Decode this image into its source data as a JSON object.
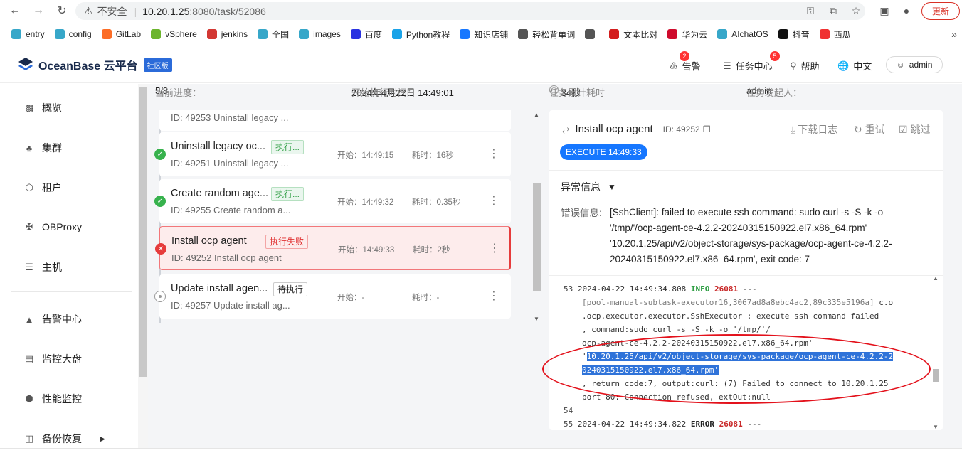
{
  "browser": {
    "not_secure": "不安全",
    "url_host": "10.20.1.25",
    "url_path": ":8080/task/52086",
    "update_label": "更新"
  },
  "bookmarks": [
    {
      "label": "entry",
      "color": "#37a7c9"
    },
    {
      "label": "config",
      "color": "#37a7c9"
    },
    {
      "label": "GitLab",
      "color": "#fc6d26"
    },
    {
      "label": "vSphere",
      "color": "#6cb52d"
    },
    {
      "label": "jenkins",
      "color": "#d33833"
    },
    {
      "label": "全国",
      "color": "#37a7c9"
    },
    {
      "label": "images",
      "color": "#37a7c9"
    },
    {
      "label": "百度",
      "color": "#2932e1"
    },
    {
      "label": "Python教程",
      "color": "#1aa3e8"
    },
    {
      "label": "知识店铺",
      "color": "#1677ff"
    },
    {
      "label": "轻松背单词",
      "color": "#555555"
    },
    {
      "label": "",
      "color": "#555555"
    },
    {
      "label": "文本比对",
      "color": "#d31d1d"
    },
    {
      "label": "华为云",
      "color": "#cf0a2c"
    },
    {
      "label": "AIchatOS",
      "color": "#37a7c9"
    },
    {
      "label": "抖音",
      "color": "#111111"
    },
    {
      "label": "西瓜",
      "color": "#f03131"
    }
  ],
  "header": {
    "brand": "OceanBase 云平台",
    "edition": "社区版",
    "alerts": "告警",
    "alerts_count": "2",
    "tasks": "任务中心",
    "tasks_count": "5",
    "help": "帮助",
    "language": "中文",
    "user": "admin"
  },
  "sidebar": {
    "items": [
      {
        "label": "概览"
      },
      {
        "label": "集群"
      },
      {
        "label": "租户"
      },
      {
        "label": "OBProxy"
      },
      {
        "label": "主机"
      },
      {
        "label": "告警中心"
      },
      {
        "label": "监控大盘"
      },
      {
        "label": "性能监控"
      },
      {
        "label": "备份恢复"
      }
    ]
  },
  "progress": {
    "label": "当前进度：",
    "value": "5/8",
    "start_label": "开始执行时间：",
    "start_value": "2024年4月22日 14:49:01",
    "cost_label": "任务累计耗时",
    "cost_value": "34秒",
    "initiator_label": "任务发起人：",
    "initiator_value": "admin"
  },
  "tasks": [
    {
      "name": "",
      "tag": "",
      "id": "ID: 49253  Uninstall legacy ...",
      "start": "",
      "cost": "",
      "status": "ok"
    },
    {
      "name": "Uninstall legacy oc...",
      "tag": "执行...",
      "id": "ID: 49251  Uninstall legacy ...",
      "start": "开始：14:49:15",
      "cost": "耗时：16秒",
      "status": "ok"
    },
    {
      "name": "Create random age...",
      "tag": "执行...",
      "id": "ID: 49255  Create random  a...",
      "start": "开始：14:49:32",
      "cost": "耗时：0.35秒",
      "status": "ok"
    },
    {
      "name": "Install ocp agent",
      "tag": "执行失败",
      "id": "ID: 49252  Install ocp agent",
      "start": "开始：14:49:33",
      "cost": "耗时：2秒",
      "status": "fail"
    },
    {
      "name": "Update install agen...",
      "tag": "待执行",
      "id": "ID: 49257  Update install ag...",
      "start": "开始：-",
      "cost": "耗时：-",
      "status": "pending"
    }
  ],
  "detail": {
    "title": "Install ocp agent",
    "id": "ID: 49252",
    "download_log": "下载日志",
    "retry": "重试",
    "skip": "跳过",
    "exec_pill": "EXECUTE 14:49:33",
    "error_section": "异常信息",
    "error_label": "错误信息:",
    "error_message": "[SshClient]: failed to execute ssh command: sudo curl -s -S -k -o '/tmp/'/ocp-agent-ce-4.2.2-20240315150922.el7.x86_64.rpm' '10.20.1.25/api/v2/object-storage/sys-package/ocp-agent-ce-4.2.2-20240315150922.el7.x86_64.rpm', exit code: 7"
  },
  "log": {
    "l53_num": "53",
    "l53_time": "2024-04-22 14:49:34.808",
    "l53_level": "INFO",
    "l53_pid": "26081",
    "l53_dash": "---",
    "l53_thread": "[pool-manual-subtask-executor16,3067ad8a8ebc4ac2,89c335e5196a]",
    "l53_cls1": "c.o",
    "l53_cls2": ".ocp.executor.executor.SshExecutor",
    "l53_msg1": ": execute ssh command failed",
    "l53_msg2": ", command:sudo curl -s -S -k -o '/tmp/'/",
    "l53_msg3": "ocp-agent-ce-4.2.2-20240315150922.el7.x86_64.rpm'",
    "l53_quote": "'",
    "l53_hl1": "10.20.1.25/api/v2/object-storage/sys-package/ocp-agent-ce-4.2.2-2",
    "l53_hl2": "0240315150922.el7.x86_64.rpm'",
    "l53_msg4": ", return code:7, output:curl: (7) Failed to connect to 10.20.1.25",
    "l53_msg5": " port 80: Connection refused, extOut:null",
    "l54_num": "54",
    "l55_num": "55",
    "l55_time": "2024-04-22 14:49:34.822",
    "l55_level": "ERROR",
    "l55_pid": "26081",
    "l55_dash": "---"
  }
}
